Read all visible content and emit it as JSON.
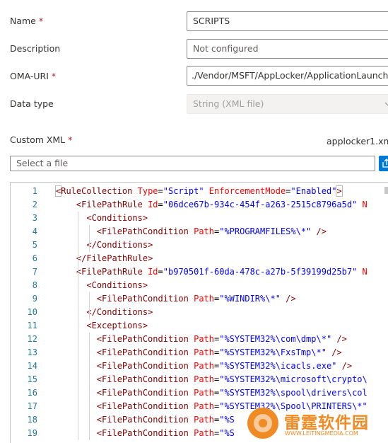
{
  "form": {
    "name": {
      "label": "Name",
      "required_mark": "*",
      "value": "SCRIPTS"
    },
    "description": {
      "label": "Description",
      "placeholder": "Not configured"
    },
    "oma_uri": {
      "label": "OMA-URI",
      "required_mark": "*",
      "value": "./Vendor/MSFT/AppLocker/ApplicationLaunch..."
    },
    "data_type": {
      "label": "Data type",
      "value": "String (XML file)"
    },
    "custom_xml": {
      "label": "Custom XML",
      "required_mark": "*",
      "filename": "applocker1.xml",
      "file_placeholder": "Select a file"
    }
  },
  "editor": {
    "lines": [
      {
        "n": "1",
        "tokens": [
          {
            "t": "br",
            "v": "<"
          },
          {
            "t": "tag",
            "v": "RuleCollection"
          },
          {
            "t": "ws",
            "v": " "
          },
          {
            "t": "attr",
            "v": "Type"
          },
          {
            "t": "eq",
            "v": "="
          },
          {
            "t": "val",
            "v": "\"Script\""
          },
          {
            "t": "ws",
            "v": " "
          },
          {
            "t": "attr",
            "v": "EnforcementMode"
          },
          {
            "t": "eq",
            "v": "="
          },
          {
            "t": "val",
            "v": "\"Enabled\""
          },
          {
            "t": "br",
            "v": ">"
          }
        ]
      },
      {
        "n": "2",
        "tokens": [
          {
            "t": "ws",
            "v": "    "
          },
          {
            "t": "br",
            "v": "<"
          },
          {
            "t": "tag",
            "v": "FilePathRule"
          },
          {
            "t": "ws",
            "v": " "
          },
          {
            "t": "attr",
            "v": "Id"
          },
          {
            "t": "eq",
            "v": "="
          },
          {
            "t": "val",
            "v": "\"06dce67b-934c-454f-a263-2515c8796a5d\""
          },
          {
            "t": "ws",
            "v": " "
          },
          {
            "t": "attr",
            "v": "N"
          }
        ]
      },
      {
        "n": "3",
        "tokens": [
          {
            "t": "ws",
            "v": "      "
          },
          {
            "t": "br",
            "v": "<"
          },
          {
            "t": "tag",
            "v": "Conditions"
          },
          {
            "t": "br",
            "v": ">"
          }
        ]
      },
      {
        "n": "4",
        "tokens": [
          {
            "t": "ws",
            "v": "        "
          },
          {
            "t": "br",
            "v": "<"
          },
          {
            "t": "tag",
            "v": "FilePathCondition"
          },
          {
            "t": "ws",
            "v": " "
          },
          {
            "t": "attr",
            "v": "Path"
          },
          {
            "t": "eq",
            "v": "="
          },
          {
            "t": "val",
            "v": "\"%PROGRAMFILES%\\*\""
          },
          {
            "t": "ws",
            "v": " "
          },
          {
            "t": "br",
            "v": "/>"
          }
        ]
      },
      {
        "n": "5",
        "tokens": [
          {
            "t": "ws",
            "v": "      "
          },
          {
            "t": "br",
            "v": "</"
          },
          {
            "t": "tag",
            "v": "Conditions"
          },
          {
            "t": "br",
            "v": ">"
          }
        ]
      },
      {
        "n": "6",
        "tokens": [
          {
            "t": "ws",
            "v": "    "
          },
          {
            "t": "br",
            "v": "</"
          },
          {
            "t": "tag",
            "v": "FilePathRule"
          },
          {
            "t": "br",
            "v": ">"
          }
        ]
      },
      {
        "n": "7",
        "tokens": [
          {
            "t": "ws",
            "v": "    "
          },
          {
            "t": "br",
            "v": "<"
          },
          {
            "t": "tag",
            "v": "FilePathRule"
          },
          {
            "t": "ws",
            "v": " "
          },
          {
            "t": "attr",
            "v": "Id"
          },
          {
            "t": "eq",
            "v": "="
          },
          {
            "t": "val",
            "v": "\"b970501f-60da-478c-a27b-5f39199d25b7\""
          },
          {
            "t": "ws",
            "v": " "
          },
          {
            "t": "attr",
            "v": "N"
          }
        ]
      },
      {
        "n": "8",
        "tokens": [
          {
            "t": "ws",
            "v": "      "
          },
          {
            "t": "br",
            "v": "<"
          },
          {
            "t": "tag",
            "v": "Conditions"
          },
          {
            "t": "br",
            "v": ">"
          }
        ]
      },
      {
        "n": "9",
        "tokens": [
          {
            "t": "ws",
            "v": "        "
          },
          {
            "t": "br",
            "v": "<"
          },
          {
            "t": "tag",
            "v": "FilePathCondition"
          },
          {
            "t": "ws",
            "v": " "
          },
          {
            "t": "attr",
            "v": "Path"
          },
          {
            "t": "eq",
            "v": "="
          },
          {
            "t": "val",
            "v": "\"%WINDIR%\\*\""
          },
          {
            "t": "ws",
            "v": " "
          },
          {
            "t": "br",
            "v": "/>"
          }
        ]
      },
      {
        "n": "10",
        "tokens": [
          {
            "t": "ws",
            "v": "      "
          },
          {
            "t": "br",
            "v": "</"
          },
          {
            "t": "tag",
            "v": "Conditions"
          },
          {
            "t": "br",
            "v": ">"
          }
        ]
      },
      {
        "n": "11",
        "tokens": [
          {
            "t": "ws",
            "v": "      "
          },
          {
            "t": "br",
            "v": "<"
          },
          {
            "t": "tag",
            "v": "Exceptions"
          },
          {
            "t": "br",
            "v": ">"
          }
        ]
      },
      {
        "n": "12",
        "tokens": [
          {
            "t": "ws",
            "v": "        "
          },
          {
            "t": "br",
            "v": "<"
          },
          {
            "t": "tag",
            "v": "FilePathCondition"
          },
          {
            "t": "ws",
            "v": " "
          },
          {
            "t": "attr",
            "v": "Path"
          },
          {
            "t": "eq",
            "v": "="
          },
          {
            "t": "val",
            "v": "\"%SYSTEM32%\\com\\dmp\\*\""
          },
          {
            "t": "ws",
            "v": " "
          },
          {
            "t": "br",
            "v": "/>"
          }
        ]
      },
      {
        "n": "13",
        "tokens": [
          {
            "t": "ws",
            "v": "        "
          },
          {
            "t": "br",
            "v": "<"
          },
          {
            "t": "tag",
            "v": "FilePathCondition"
          },
          {
            "t": "ws",
            "v": " "
          },
          {
            "t": "attr",
            "v": "Path"
          },
          {
            "t": "eq",
            "v": "="
          },
          {
            "t": "val",
            "v": "\"%SYSTEM32%\\FxsTmp\\*\""
          },
          {
            "t": "ws",
            "v": " "
          },
          {
            "t": "br",
            "v": "/>"
          }
        ]
      },
      {
        "n": "14",
        "tokens": [
          {
            "t": "ws",
            "v": "        "
          },
          {
            "t": "br",
            "v": "<"
          },
          {
            "t": "tag",
            "v": "FilePathCondition"
          },
          {
            "t": "ws",
            "v": " "
          },
          {
            "t": "attr",
            "v": "Path"
          },
          {
            "t": "eq",
            "v": "="
          },
          {
            "t": "val",
            "v": "\"%SYSTEM32%\\icacls.exe\""
          },
          {
            "t": "ws",
            "v": " "
          },
          {
            "t": "br",
            "v": "/>"
          }
        ]
      },
      {
        "n": "15",
        "tokens": [
          {
            "t": "ws",
            "v": "        "
          },
          {
            "t": "br",
            "v": "<"
          },
          {
            "t": "tag",
            "v": "FilePathCondition"
          },
          {
            "t": "ws",
            "v": " "
          },
          {
            "t": "attr",
            "v": "Path"
          },
          {
            "t": "eq",
            "v": "="
          },
          {
            "t": "val",
            "v": "\"%SYSTEM32%\\microsoft\\crypto\\"
          }
        ]
      },
      {
        "n": "16",
        "tokens": [
          {
            "t": "ws",
            "v": "        "
          },
          {
            "t": "br",
            "v": "<"
          },
          {
            "t": "tag",
            "v": "FilePathCondition"
          },
          {
            "t": "ws",
            "v": " "
          },
          {
            "t": "attr",
            "v": "Path"
          },
          {
            "t": "eq",
            "v": "="
          },
          {
            "t": "val",
            "v": "\"%SYSTEM32%\\spool\\drivers\\col"
          }
        ]
      },
      {
        "n": "17",
        "tokens": [
          {
            "t": "ws",
            "v": "        "
          },
          {
            "t": "br",
            "v": "<"
          },
          {
            "t": "tag",
            "v": "FilePathCondition"
          },
          {
            "t": "ws",
            "v": " "
          },
          {
            "t": "attr",
            "v": "Path"
          },
          {
            "t": "eq",
            "v": "="
          },
          {
            "t": "val",
            "v": "\"%SYSTEM32%\\Spool\\PRINTERS\\*\""
          }
        ]
      },
      {
        "n": "18",
        "tokens": [
          {
            "t": "ws",
            "v": "        "
          },
          {
            "t": "br",
            "v": "<"
          },
          {
            "t": "tag",
            "v": "FilePathCondition"
          },
          {
            "t": "ws",
            "v": " "
          },
          {
            "t": "attr",
            "v": "Path"
          },
          {
            "t": "eq",
            "v": "="
          },
          {
            "t": "val",
            "v": "\"%S"
          }
        ]
      },
      {
        "n": "19",
        "tokens": [
          {
            "t": "ws",
            "v": "        "
          },
          {
            "t": "br",
            "v": "<"
          },
          {
            "t": "tag",
            "v": "FilePathCondition"
          },
          {
            "t": "ws",
            "v": " "
          },
          {
            "t": "attr",
            "v": "Path"
          },
          {
            "t": "eq",
            "v": "="
          },
          {
            "t": "val",
            "v": "\"%S"
          }
        ]
      }
    ]
  },
  "watermark": {
    "title": "雷霆软件园",
    "url": "WWW.LEITINGMEDIA.COM"
  },
  "colors": {
    "accent": "#0078d4",
    "required": "#a4262c",
    "watermark": "#f08a24"
  }
}
